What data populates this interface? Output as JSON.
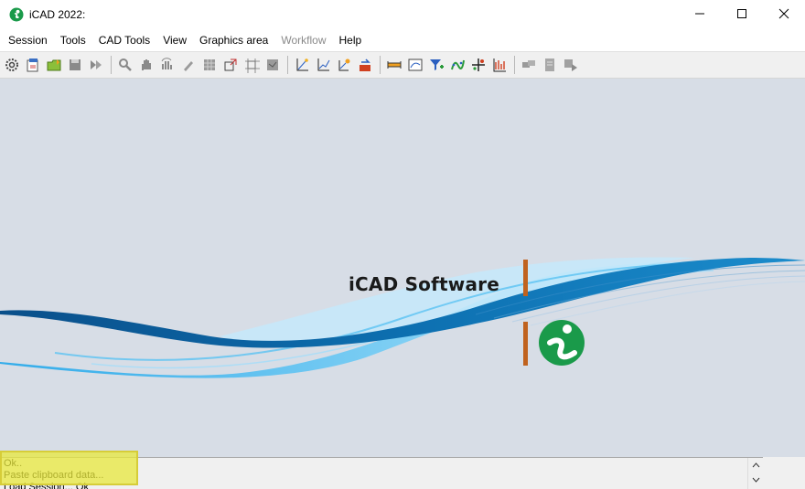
{
  "window": {
    "title": "iCAD 2022:",
    "controls": [
      "minimize-icon",
      "maximize-icon",
      "close-icon"
    ]
  },
  "menu": [
    {
      "label": "Session",
      "enabled": true
    },
    {
      "label": "Tools",
      "enabled": true
    },
    {
      "label": "CAD Tools",
      "enabled": true
    },
    {
      "label": "View",
      "enabled": true
    },
    {
      "label": "Graphics area",
      "enabled": true
    },
    {
      "label": "Workflow",
      "enabled": false
    },
    {
      "label": "Help",
      "enabled": true
    }
  ],
  "toolbar": {
    "groups": [
      [
        "settings-gear-icon",
        "new-session-icon",
        "open-folder-icon",
        "save-disk-icon",
        "export-arrow-icon"
      ],
      [
        "zoom-icon",
        "pan-hand-icon",
        "rotate-hand-icon",
        "pen-icon",
        "grid-cube-icon",
        "fit-view-icon",
        "frame-icon",
        "layers-icon"
      ],
      [
        "axis-plot-icon",
        "axis-graph-icon",
        "axis-star-icon",
        "data-export-icon"
      ],
      [
        "measure-ruler-icon",
        "chart-window-icon",
        "filter-add-icon",
        "curve-fit-icon",
        "crosshair-icon",
        "frequency-plot-icon"
      ],
      [
        "macro-icon",
        "document-icon",
        "forward-icon"
      ]
    ]
  },
  "canvas": {
    "logo_text": "iCAD Software",
    "background": "#d7dde6",
    "accent_orange": "#c0621e",
    "logo_green": "#1a9a4a"
  },
  "console": {
    "lines": [
      "Ok..",
      "Paste clipboard data...",
      "Load Session... Ok"
    ],
    "highlight_color": "#e8e83c"
  }
}
